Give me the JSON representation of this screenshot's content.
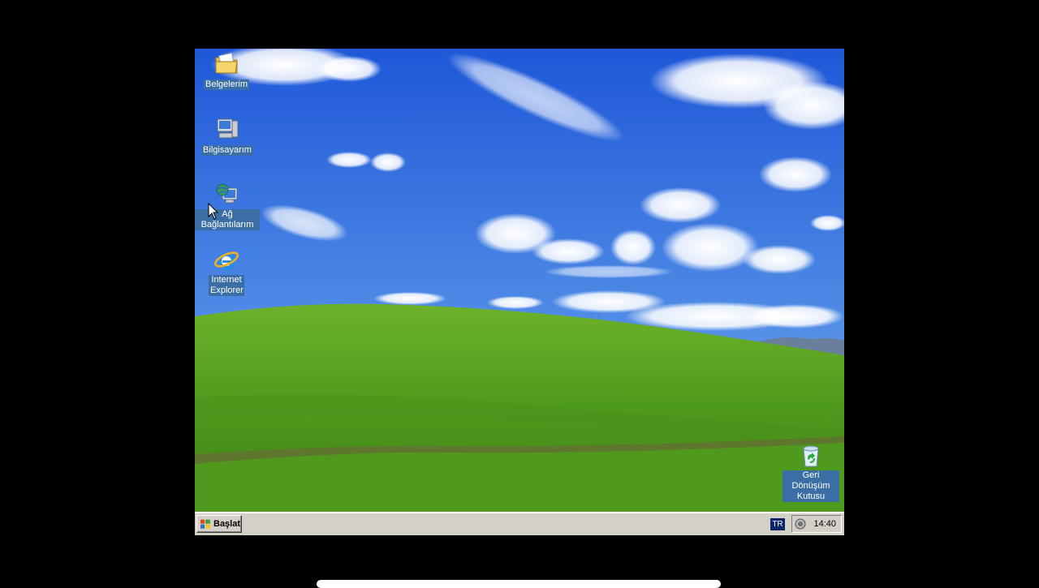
{
  "desktop": {
    "icons": [
      {
        "label": "Belgelerim",
        "icon": "my-documents-folder-icon"
      },
      {
        "label": "Bilgisayarım",
        "icon": "my-computer-icon"
      },
      {
        "label": "Ağ Bağlantılarım",
        "icon": "network-connections-icon"
      },
      {
        "label": "Internet Explorer",
        "icon": "internet-explorer-icon"
      }
    ],
    "recycle_bin": {
      "label": "Geri Dönüşüm Kutusu",
      "icon": "recycle-bin-icon"
    }
  },
  "taskbar": {
    "start_label": "Başlat",
    "language": "TR",
    "clock": "14:40"
  },
  "colors": {
    "sky_top": "#1f58d8",
    "sky_bottom": "#9ec4f2",
    "grass_top": "#6eb22a",
    "grass_bottom": "#3d7a14",
    "label_bg": "#3a6ea5",
    "taskbar": "#d4d0c8"
  }
}
